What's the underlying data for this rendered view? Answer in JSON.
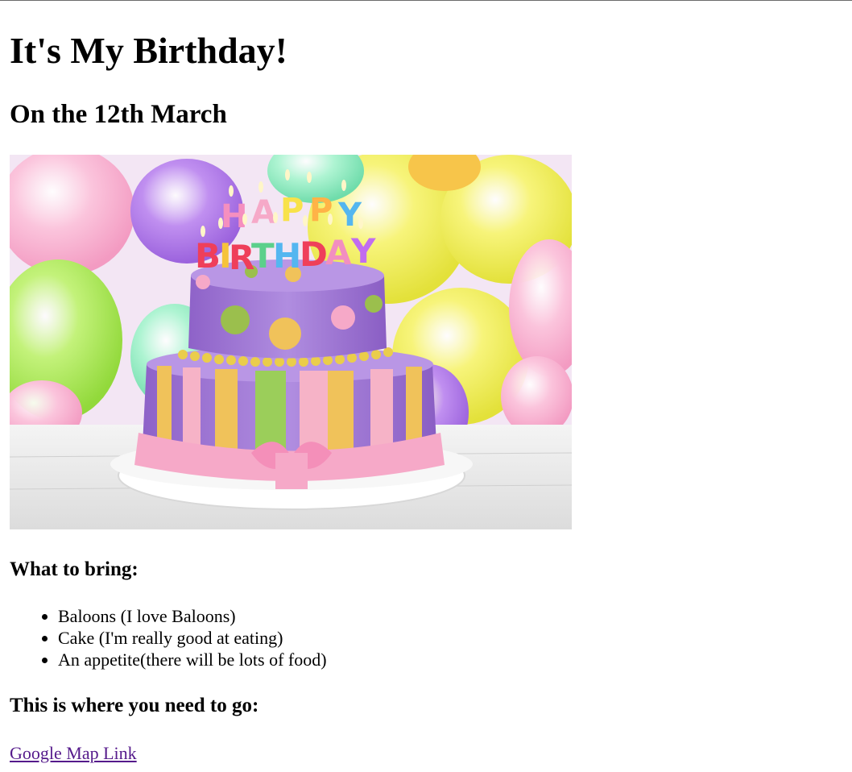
{
  "header": {
    "title": "It's My Birthday!",
    "subtitle": "On the 12th March"
  },
  "image": {
    "description_icon": "birthday-cake-image",
    "candle_letters_top": "HAPPY",
    "candle_letters_bottom": "BIRTHDAY"
  },
  "bring": {
    "heading": "What to bring:",
    "items": [
      "Baloons (I love Baloons)",
      "Cake (I'm really good at eating)",
      "An appetite(there will be lots of food)"
    ]
  },
  "directions": {
    "heading": "This is where you need to go:",
    "link_label": "Google Map Link"
  },
  "colors": {
    "link_visited": "#551a8b",
    "text": "#000000",
    "background": "#ffffff"
  }
}
